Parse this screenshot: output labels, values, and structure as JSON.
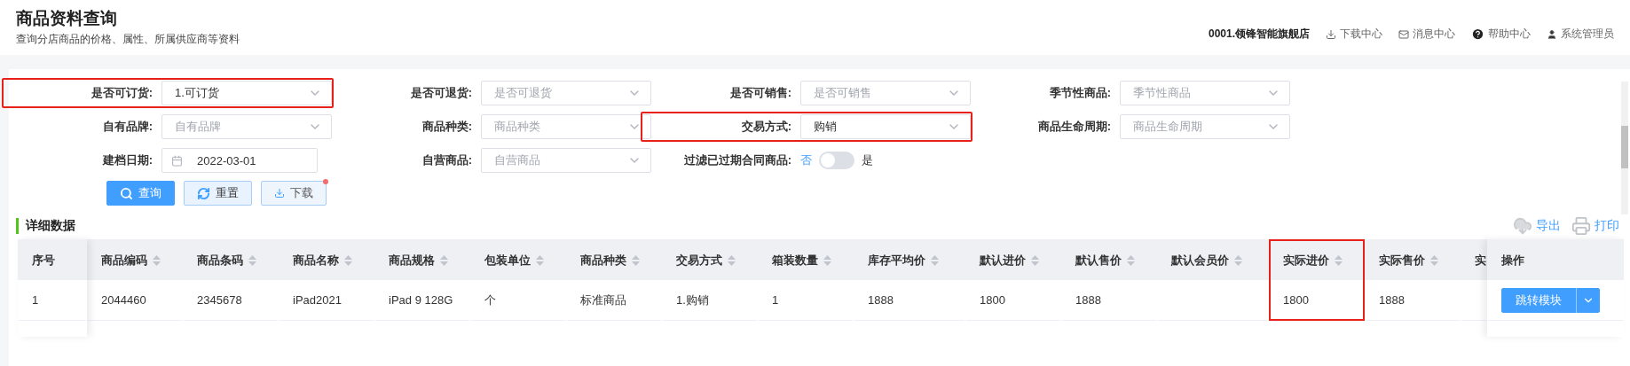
{
  "header": {
    "title": "商品资料查询",
    "subtitle": "查询分店商品的价格、属性、所属供应商等资料",
    "store": "0001.领锋智能旗舰店",
    "links": [
      {
        "kind": "download",
        "label": "下载中心"
      },
      {
        "kind": "mail",
        "label": "消息中心"
      },
      {
        "kind": "help",
        "label": "帮助中心"
      },
      {
        "kind": "user",
        "label": "系统管理员"
      }
    ]
  },
  "filters": [
    {
      "kind": "select",
      "label": "是否可订货:",
      "value": "1.可订货",
      "highlighted": true
    },
    {
      "kind": "select",
      "label": "是否可退货:",
      "placeholder": "是否可退货",
      "highlighted": false
    },
    {
      "kind": "select",
      "label": "是否可销售:",
      "placeholder": "是否可销售",
      "highlighted": false
    },
    {
      "kind": "select",
      "label": "季节性商品:",
      "placeholder": "季节性商品",
      "highlighted": false
    },
    {
      "kind": "select",
      "label": "自有品牌:",
      "placeholder": "自有品牌",
      "highlighted": false
    },
    {
      "kind": "select",
      "label": "商品种类:",
      "placeholder": "商品种类",
      "highlighted": false
    },
    {
      "kind": "select",
      "label": "交易方式:",
      "value": "购销",
      "highlighted": true
    },
    {
      "kind": "select",
      "label": "商品生命周期:",
      "placeholder": "商品生命周期",
      "highlighted": false
    },
    {
      "kind": "date",
      "label": "建档日期:",
      "value": "2022-03-01",
      "highlighted": false
    },
    {
      "kind": "select",
      "label": "自营商品:",
      "placeholder": "自营商品",
      "highlighted": false
    },
    {
      "kind": "toggle",
      "label": "过滤已过期合同商品:",
      "off_label": "否",
      "on_label": "是",
      "on": false,
      "highlighted": false
    }
  ],
  "actions": [
    {
      "kind": "search",
      "label": "查询",
      "badge": false
    },
    {
      "kind": "reset",
      "label": "重置",
      "badge": false
    },
    {
      "kind": "download",
      "label": "下载",
      "badge": true
    }
  ],
  "section": {
    "title": "详细数据",
    "tools": [
      {
        "kind": "export",
        "label": "导出"
      },
      {
        "kind": "print",
        "label": "打印"
      }
    ]
  },
  "table": {
    "columns": [
      {
        "label": "序号",
        "sortable": false,
        "highlighted": false
      },
      {
        "label": "商品编码",
        "sortable": true,
        "highlighted": false
      },
      {
        "label": "商品条码",
        "sortable": true,
        "highlighted": false
      },
      {
        "label": "商品名称",
        "sortable": true,
        "highlighted": false
      },
      {
        "label": "商品规格",
        "sortable": true,
        "highlighted": false
      },
      {
        "label": "包装单位",
        "sortable": true,
        "highlighted": false
      },
      {
        "label": "商品种类",
        "sortable": true,
        "highlighted": false
      },
      {
        "label": "交易方式",
        "sortable": true,
        "highlighted": false
      },
      {
        "label": "箱装数量",
        "sortable": true,
        "highlighted": false
      },
      {
        "label": "库存平均价",
        "sortable": true,
        "highlighted": false
      },
      {
        "label": "默认进价",
        "sortable": true,
        "highlighted": false
      },
      {
        "label": "默认售价",
        "sortable": true,
        "highlighted": false
      },
      {
        "label": "默认会员价",
        "sortable": true,
        "highlighted": false
      },
      {
        "label": "实际进价",
        "sortable": true,
        "highlighted": true
      },
      {
        "label": "实际售价",
        "sortable": true,
        "highlighted": false
      },
      {
        "label": "实",
        "sortable": false,
        "highlighted": false
      }
    ],
    "action_column": "操作",
    "rows": [
      {
        "cells": [
          "1",
          "2044460",
          "2345678",
          "iPad2021",
          "iPad 9 128G",
          "个",
          "标准商品",
          "1.购销",
          "1",
          "1888",
          "1800",
          "1888",
          null,
          "1800",
          "1888",
          null
        ],
        "action": "跳转模块"
      }
    ]
  }
}
